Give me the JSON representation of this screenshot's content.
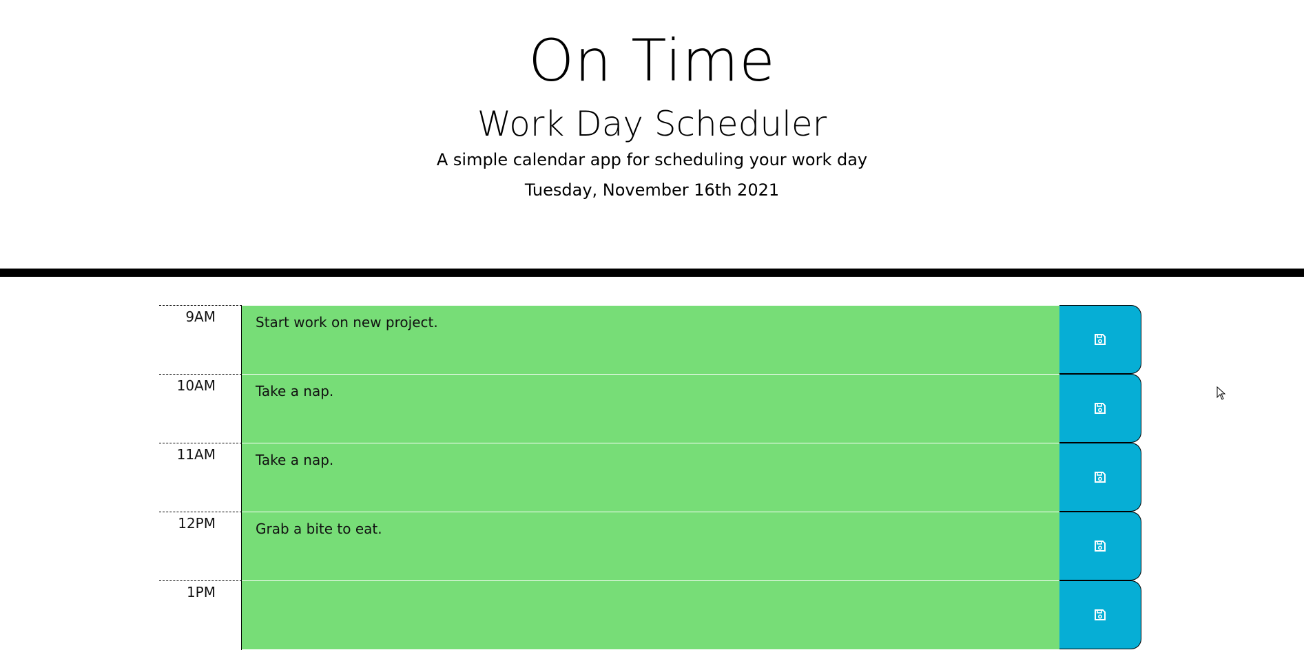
{
  "header": {
    "title": "On Time",
    "subtitle": "Work Day Scheduler",
    "lead": "A simple calendar app for scheduling your work day",
    "current_day": "Tuesday, November 16th 2021"
  },
  "colors": {
    "present": "#77dd77",
    "save_button": "#06aed5",
    "divider": "#000000"
  },
  "time_blocks": [
    {
      "hour": "9AM",
      "description": "Start work on new project.",
      "save_icon": "floppy-disk-icon"
    },
    {
      "hour": "10AM",
      "description": "Take a nap.",
      "save_icon": "floppy-disk-icon"
    },
    {
      "hour": "11AM",
      "description": "Take a nap.",
      "save_icon": "floppy-disk-icon"
    },
    {
      "hour": "12PM",
      "description": "Grab a bite to eat.",
      "save_icon": "floppy-disk-icon"
    },
    {
      "hour": "1PM",
      "description": "",
      "save_icon": "floppy-disk-icon"
    }
  ]
}
